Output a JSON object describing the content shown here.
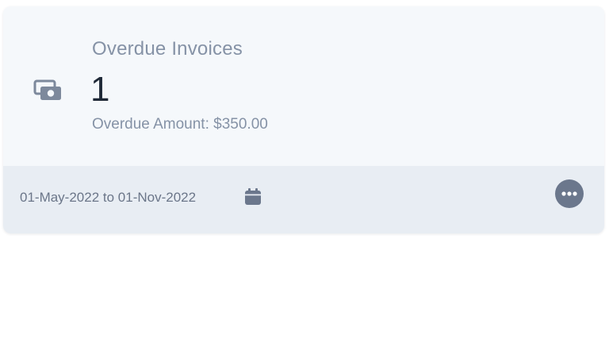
{
  "card": {
    "title": "Overdue Invoices",
    "value": "1",
    "subtext": "Overdue Amount: $350.00",
    "icon": "money-icon",
    "footer": {
      "date_range": "01-May-2022 to 01-Nov-2022",
      "calendar_icon": "calendar-icon",
      "more_icon": "more-options-icon"
    }
  },
  "colors": {
    "card_background": "#f5f8fb",
    "footer_background": "#e8edf3",
    "muted_text": "#8592a6",
    "value_text": "#1f2937",
    "icon_gray": "#6b778c"
  }
}
